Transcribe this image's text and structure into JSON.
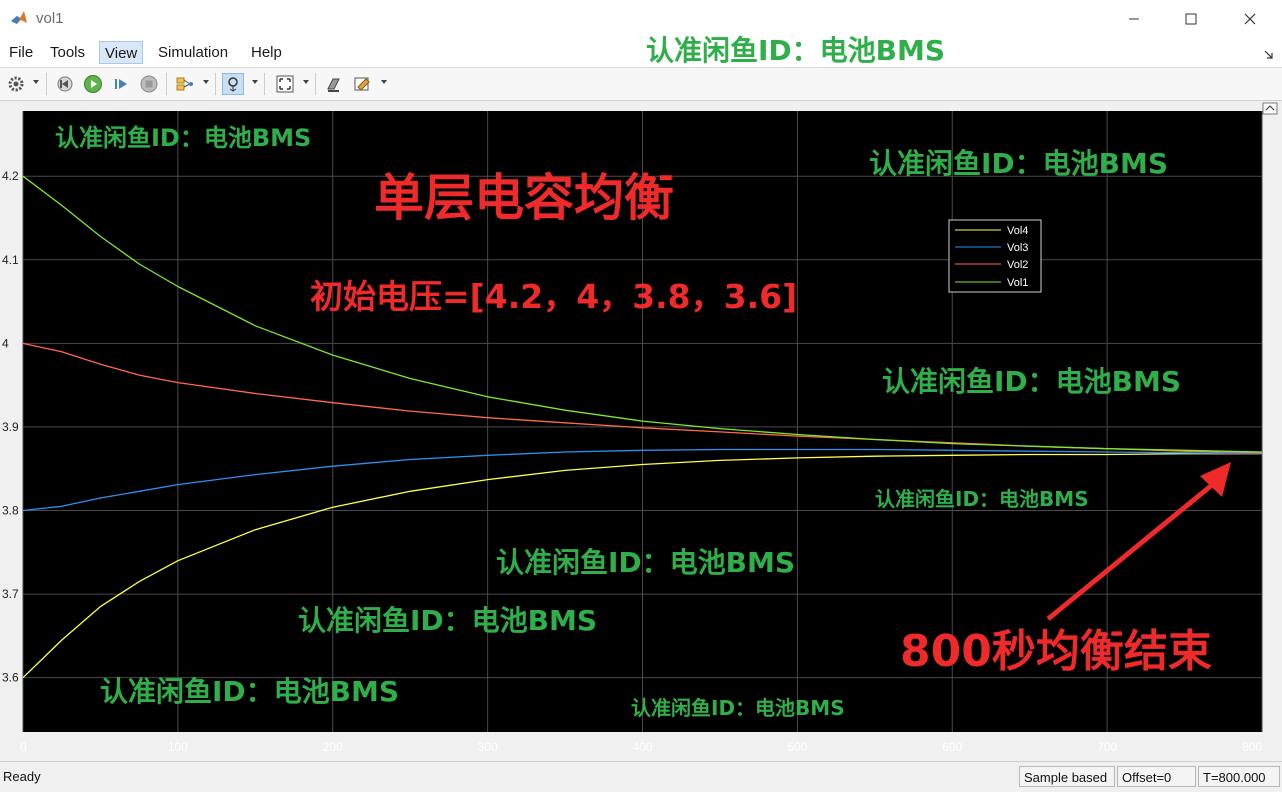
{
  "window": {
    "title": "vol1",
    "watermark_header": "认准闲鱼ID：电池BMS"
  },
  "menu": {
    "file": "File",
    "tools": "Tools",
    "view": "View",
    "simulation": "Simulation",
    "help": "Help"
  },
  "status": {
    "ready": "Ready",
    "mode": "Sample based",
    "offset": "Offset=0",
    "time": "T=800.000"
  },
  "chart_data": {
    "type": "line",
    "title": "单层电容均衡",
    "subtitle": "初始电压=[4.2，4，3.8，3.6]",
    "xlabel": "",
    "ylabel": "",
    "xlim": [
      0,
      800
    ],
    "ylim": [
      3.535,
      4.278
    ],
    "xticks": [
      0,
      100,
      200,
      300,
      400,
      500,
      600,
      700,
      800
    ],
    "yticks": [
      3.6,
      3.7,
      3.8,
      3.9,
      4,
      4.1,
      4.2
    ],
    "grid": true,
    "legend_position": "top-right",
    "annotation": "800秒均衡结束",
    "x": [
      0,
      25,
      50,
      75,
      100,
      150,
      200,
      250,
      300,
      350,
      400,
      450,
      500,
      550,
      600,
      650,
      700,
      750,
      800
    ],
    "series": [
      {
        "name": "Vol4",
        "color": "#ffff4d",
        "values": [
          3.6,
          3.645,
          3.685,
          3.715,
          3.74,
          3.777,
          3.804,
          3.823,
          3.837,
          3.848,
          3.855,
          3.86,
          3.863,
          3.865,
          3.866,
          3.867,
          3.867,
          3.868,
          3.868
        ]
      },
      {
        "name": "Vol3",
        "color": "#2f8ff0",
        "values": [
          3.8,
          3.805,
          3.815,
          3.823,
          3.831,
          3.843,
          3.853,
          3.861,
          3.866,
          3.87,
          3.872,
          3.873,
          3.873,
          3.873,
          3.872,
          3.871,
          3.87,
          3.869,
          3.868
        ]
      },
      {
        "name": "Vol2",
        "color": "#ff6a4a",
        "values": [
          4.0,
          3.99,
          3.975,
          3.962,
          3.953,
          3.94,
          3.929,
          3.919,
          3.911,
          3.905,
          3.899,
          3.894,
          3.889,
          3.885,
          3.881,
          3.877,
          3.874,
          3.871,
          3.869
        ]
      },
      {
        "name": "Vol1",
        "color": "#7ee82f",
        "values": [
          4.2,
          4.165,
          4.128,
          4.095,
          4.068,
          4.021,
          3.986,
          3.958,
          3.936,
          3.92,
          3.907,
          3.898,
          3.891,
          3.885,
          3.88,
          3.877,
          3.874,
          3.872,
          3.87
        ]
      }
    ]
  },
  "watermarks": [
    "认准闲鱼ID：电池BMS",
    "认准闲鱼ID：电池BMS",
    "认准闲鱼ID：电池BMS",
    "认准闲鱼ID：电池BMS",
    "认准闲鱼ID：电池BMS",
    "认准闲鱼ID：电池BMS",
    "认准闲鱼ID：电池BMS",
    "认准闲鱼ID：电池BMS"
  ]
}
